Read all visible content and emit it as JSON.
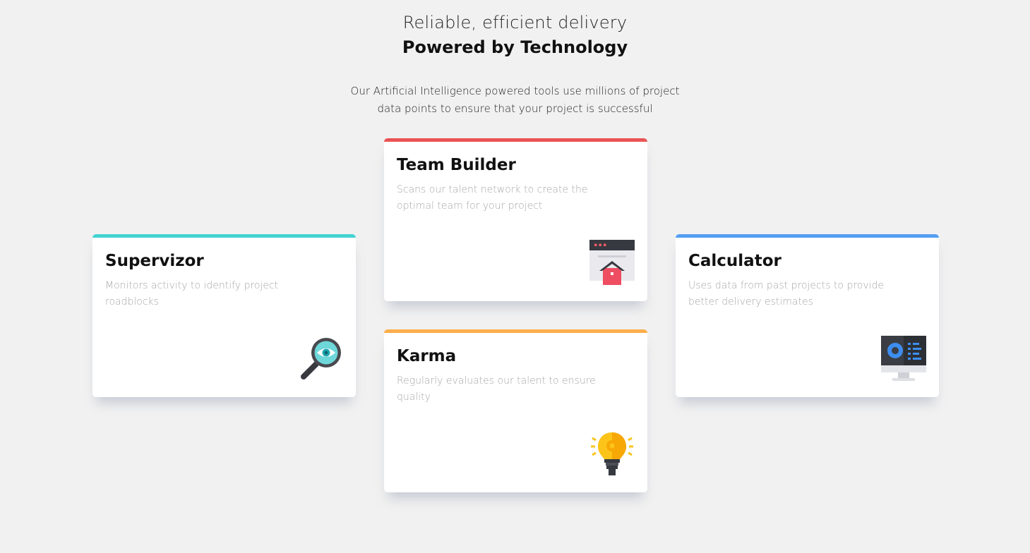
{
  "header": {
    "subtitle": "Reliable, efficient delivery",
    "title": "Powered by Technology"
  },
  "intro": "Our Artificial Intelligence powered tools use millions of project data points to ensure that your project is successful",
  "cards": {
    "supervisor": {
      "title": "Supervizor",
      "description": "Monitors activity to identify project roadblocks",
      "accent": "#44d3d2",
      "icon": "magnifier-eye-icon"
    },
    "team_builder": {
      "title": "Team Builder",
      "description": "Scans our talent network to create the optimal team for your project",
      "accent": "#ea5454",
      "icon": "browser-house-icon"
    },
    "karma": {
      "title": "Karma",
      "description": "Regularly evaluates our talent to ensure quality",
      "accent": "#fcae4a",
      "icon": "light-bulb-icon"
    },
    "calculator": {
      "title": "Calculator",
      "description": "Uses data from past projects to provide better delivery estimates",
      "accent": "#549ef2",
      "icon": "monitor-chart-icon"
    }
  }
}
